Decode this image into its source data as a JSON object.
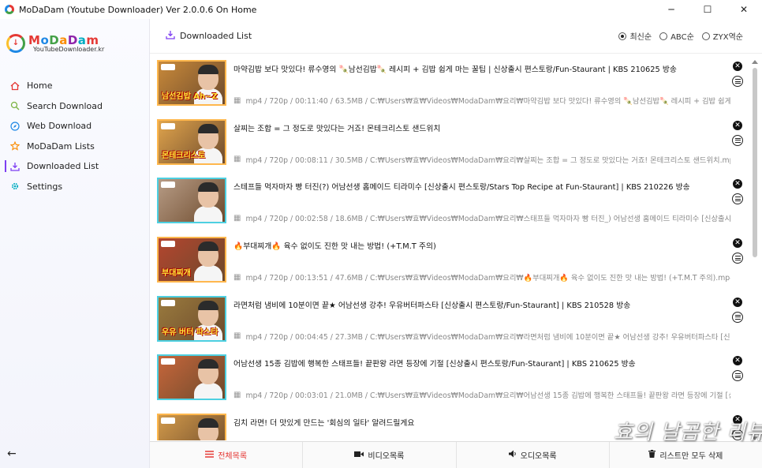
{
  "window": {
    "title": "MoDaDam (Youtube Downloader) Ver 2.0.0.6 On Home",
    "controls": [
      "─",
      "☐",
      "✕"
    ]
  },
  "logo": {
    "letters": [
      "M",
      "o",
      "D",
      "a",
      "D",
      "a",
      "m"
    ],
    "subtitle": "YouTubeDownloader.kr"
  },
  "sidebar": {
    "items": [
      {
        "label": "Home",
        "icon": "home-icon",
        "color": "#e53935"
      },
      {
        "label": "Search Download",
        "icon": "search-icon",
        "color": "#7cb342"
      },
      {
        "label": "Web Download",
        "icon": "compass-icon",
        "color": "#1e88e5"
      },
      {
        "label": "MoDaDam Lists",
        "icon": "star-icon",
        "color": "#fb8c00"
      },
      {
        "label": "Downloaded List",
        "icon": "download-tray-icon",
        "color": "#7e3ff2",
        "active": true
      },
      {
        "label": "Settings",
        "icon": "gear-icon",
        "color": "#00acc1"
      }
    ],
    "back": "←"
  },
  "header": {
    "title": "Downloaded List",
    "sort": [
      {
        "label": "최신순",
        "selected": true
      },
      {
        "label": "ABC순",
        "selected": false
      },
      {
        "label": "ZYX역순",
        "selected": false
      }
    ]
  },
  "items": [
    {
      "title": "마약김밥 보다 맛있다! 류수영의 🍡남선김밥🍡 레시피 + 김밥 쉽게 마는 꿀팁 | 신상출시 편스토랑/Fun-Staurant | KBS 210625 방송",
      "meta": "mp4 / 720p / 00:11:40 / 63.5MB / C:₩Users₩효₩Videos₩ModaDam₩요리₩마약김밥 보다 맛있다! 류수영의 🍡남선김밥🍡 레시피 + 김밥 쉽게 마는 꿀팁",
      "thumb_caption": "남선김밥 Ah~Z",
      "thumb_bg": "#c98a3a",
      "border": "orange"
    },
    {
      "title": "살찌는 조합 = 그 정도로 맛있다는 거죠! 몬테크리스토 샌드위치",
      "meta": "mp4 / 720p / 00:08:11 / 30.5MB / C:₩Users₩효₩Videos₩ModaDam₩요리₩살찌는 조합 = 그 정도로 맛있다는 거죠! 몬테크리스토 샌드위치.mp4",
      "thumb_caption": "몬테크리스토",
      "thumb_bg": "#e0a44c",
      "border": "orange"
    },
    {
      "title": "스테프들 먹자마자 빵 터진(?) 어남선생 홈메이드 티라미수 [신상출시 편스토랑/Stars Top Recipe at Fun-Staurant] | KBS 210226 방송",
      "meta": "mp4 / 720p / 00:02:58 / 18.6MB / C:₩Users₩효₩Videos₩ModaDam₩요리₩스태프들 먹자마자 빵 터진_) 어남선생 홈메이드 티라미수 [신상출시 편스토랑/Stars Top Recipe",
      "thumb_caption": "",
      "thumb_bg": "#b79c86",
      "border": "teal"
    },
    {
      "title": "🔥부대찌개🔥 육수 없이도 진한 맛 내는 방법! (+T.M.T 주의)",
      "meta": "mp4 / 720p / 00:13:51 / 47.6MB / C:₩Users₩효₩Videos₩ModaDam₩요리₩🔥부대찌개🔥 육수 없이도 진한 맛 내는 방법! (+T.M.T 주의).mp4",
      "thumb_caption": "부대찌개",
      "thumb_bg": "#b4452f",
      "border": "orange"
    },
    {
      "title": "라면처럼 냄비에 10분이면 끝★ 어남선생 강추! 우유버터파스타 [신상출시 편스토랑/Fun-Staurant] | KBS 210528 방송",
      "meta": "mp4 / 720p / 00:04:45 / 27.3MB / C:₩Users₩효₩Videos₩ModaDam₩요리₩라면처럼 냄비에 10분이면 끝★ 어남선생 강추! 우유버터파스타 [신상출시 편스토랑/Fun-Sta",
      "thumb_caption": "우유 버터 파스타",
      "thumb_bg": "#9a7b3e",
      "border": "teal"
    },
    {
      "title": "어남선생 15종 김밥에 행복한 스태프들! 끝판왕 라면 등장에 기절 [신상출시 편스토랑/Fun-Staurant] | KBS 210625 방송",
      "meta": "mp4 / 720p / 00:03:01 / 21.0MB / C:₩Users₩효₩Videos₩ModaDam₩요리₩어남선생 15종 김밥에 행복한 스태프들! 끝판왕 라면 등장에 기절 [신상출시 편스토랑/Fun-St",
      "thumb_caption": "",
      "thumb_bg": "#c7663b",
      "border": "teal"
    },
    {
      "title": "김치 라면! 더 맛있게 만드는 '회심의 일타' 알려드릴게요",
      "meta": "",
      "thumb_caption": "",
      "thumb_bg": "#d29a4a",
      "border": "orange"
    }
  ],
  "bottom_tabs": [
    {
      "label": "전체목록",
      "icon": "list-icon",
      "active": true
    },
    {
      "label": "비디오목록",
      "icon": "video-camera-icon",
      "active": false
    },
    {
      "label": "오디오목록",
      "icon": "speaker-icon",
      "active": false
    },
    {
      "label": "리스트만 모두 삭제",
      "icon": "trash-icon",
      "active": false
    }
  ],
  "watermark": "효의 날곰한 리뷰",
  "colors": {
    "accent": "#7e3ff2",
    "active_tab": "#e53935",
    "border_orange": "#ffb74d",
    "border_teal": "#4dd0e1"
  }
}
